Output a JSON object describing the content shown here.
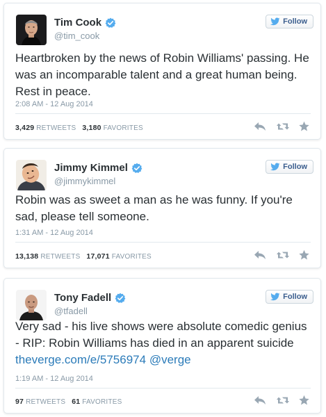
{
  "follow_label": "Follow",
  "tweets": [
    {
      "name": "Tim Cook",
      "handle": "@tim_cook",
      "text": "Heartbroken by the news of Robin Williams' passing. He was an incomparable talent and a great human being. Rest in peace.",
      "timestamp": "2:08 AM - 12 Aug 2014",
      "retweets": "3,429",
      "retweets_label": "RETWEETS",
      "favorites": "3,180",
      "favorites_label": "FAVORITES"
    },
    {
      "name": "Jimmy Kimmel",
      "handle": "@jimmykimmel",
      "text": "Robin was as sweet a man as he was funny.  If you're sad, please tell someone.",
      "timestamp": "1:31 AM - 12 Aug 2014",
      "retweets": "13,138",
      "retweets_label": "RETWEETS",
      "favorites": "17,071",
      "favorites_label": "FAVORITES"
    },
    {
      "name": "Tony Fadell",
      "handle": "@tfadell",
      "text": "Very sad - his live shows were absolute comedic genius - RIP: Robin Williams has died in an apparent suicide",
      "link": "theverge.com/e/5756974",
      "mention": "@verge",
      "timestamp": "1:19 AM - 12 Aug 2014",
      "retweets": "97",
      "retweets_label": "RETWEETS",
      "favorites": "61",
      "favorites_label": "FAVORITES"
    }
  ],
  "colors": {
    "link": "#2b7bb9",
    "verified": "#55acee",
    "meta": "#8899a6",
    "text": "#292f33",
    "follow_text": "#3b5e8e"
  },
  "icons": [
    "verified-badge-icon",
    "twitter-bird-icon",
    "reply-icon",
    "retweet-icon",
    "favorite-star-icon"
  ]
}
